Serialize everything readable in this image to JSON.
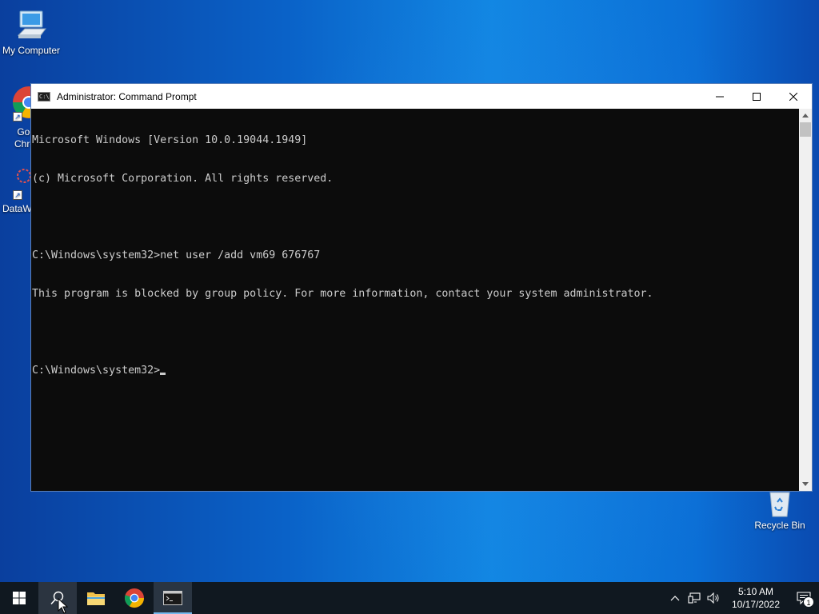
{
  "desktop": {
    "icons": {
      "my_computer": "My Computer",
      "chrome_partial": "Goo\nChro",
      "dataw_partial": "DataW",
      "recycle_bin": "Recycle Bin"
    }
  },
  "cmd_window": {
    "title": "Administrator: Command Prompt",
    "lines": [
      "Microsoft Windows [Version 10.0.19044.1949]",
      "(c) Microsoft Corporation. All rights reserved.",
      "",
      "C:\\Windows\\system32>net user /add vm69 676767",
      "This program is blocked by group policy. For more information, contact your system administrator.",
      "",
      "C:\\Windows\\system32>"
    ],
    "controls": {
      "minimize": "minimize-icon",
      "maximize": "maximize-icon",
      "close": "close-icon"
    }
  },
  "taskbar": {
    "buttons": [
      "windows-start-icon",
      "search-icon",
      "file-explorer-icon",
      "chrome-icon",
      "command-prompt-icon"
    ],
    "clock": {
      "time": "5:10 AM",
      "date": "10/17/2022"
    },
    "notification_count": "1"
  },
  "colors": {
    "console_bg": "#0c0c0c",
    "console_text": "#cccccc",
    "taskbar_bg": "#101820",
    "accent": "#76b9ed"
  }
}
